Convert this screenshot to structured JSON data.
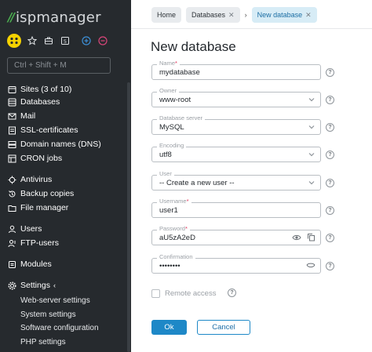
{
  "app": {
    "logo_mark": "//",
    "logo_text": "ispmanager"
  },
  "sidebar": {
    "search_placeholder": "Ctrl + Shift + M",
    "items": [
      {
        "label": "Sites (3 of 10)",
        "icon": "sites-icon"
      },
      {
        "label": "Databases",
        "icon": "database-icon"
      },
      {
        "label": "Mail",
        "icon": "mail-icon"
      },
      {
        "label": "SSL-certificates",
        "icon": "certificate-icon"
      },
      {
        "label": "Domain names (DNS)",
        "icon": "dns-icon"
      },
      {
        "label": "CRON jobs",
        "icon": "cron-icon"
      },
      {
        "label": "Antivirus",
        "icon": "antivirus-icon"
      },
      {
        "label": "Backup copies",
        "icon": "backup-icon"
      },
      {
        "label": "File manager",
        "icon": "folder-icon"
      },
      {
        "label": "Users",
        "icon": "user-icon"
      },
      {
        "label": "FTP-users",
        "icon": "ftp-icon"
      },
      {
        "label": "Modules",
        "icon": "modules-icon"
      },
      {
        "label": "Settings",
        "icon": "gear-icon"
      }
    ],
    "settings_sub": [
      "Web-server settings",
      "System settings",
      "Software configuration",
      "PHP settings"
    ]
  },
  "breadcrumbs": {
    "home": "Home",
    "databases": "Databases",
    "current": "New database"
  },
  "page": {
    "title": "New database"
  },
  "form": {
    "name": {
      "label": "Name",
      "value": "mydatabase",
      "required": "*"
    },
    "owner": {
      "label": "Owner",
      "value": "www-root"
    },
    "server": {
      "label": "Database server",
      "value": "MySQL"
    },
    "encoding": {
      "label": "Encoding",
      "value": "utf8"
    },
    "user": {
      "label": "User",
      "value": "-- Create a new user --"
    },
    "username": {
      "label": "Username",
      "value": "user1",
      "required": "*"
    },
    "password": {
      "label": "Password",
      "value": "aU5zA2eD",
      "required": "*"
    },
    "confirmation": {
      "label": "Confirmation",
      "value": "••••••••"
    },
    "remote_access": {
      "label": "Remote access",
      "checked": false
    },
    "help_symbol": "?"
  },
  "actions": {
    "ok": "Ok",
    "cancel": "Cancel"
  },
  "colors": {
    "sidebar_bg": "#262a2e",
    "accent": "#1e88c7",
    "logo_green": "#4caf50",
    "required": "#e0335a",
    "avatar": "#f5d200"
  }
}
